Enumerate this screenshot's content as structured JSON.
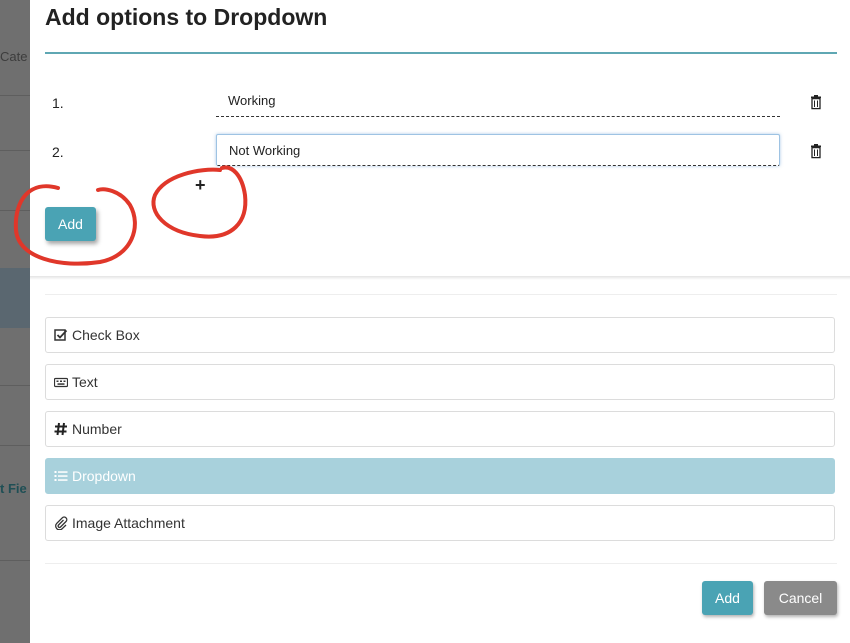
{
  "background_app": {
    "fragments": [
      "Cate",
      "t Fie"
    ]
  },
  "modal": {
    "title": "Add options to Dropdown",
    "options": [
      {
        "number": "1.",
        "value": "Working",
        "delete_icon": "trash-icon"
      },
      {
        "number": "2.",
        "value": "Not Working",
        "delete_icon": "trash-icon"
      }
    ],
    "add_row_symbol": "+",
    "add_option_label": "Add",
    "field_types": [
      {
        "label": "Check Box",
        "icon": "checkbox-icon",
        "selected": false
      },
      {
        "label": "Text",
        "icon": "keyboard-icon",
        "selected": false
      },
      {
        "label": "Number",
        "icon": "hash-icon",
        "selected": false
      },
      {
        "label": "Dropdown",
        "icon": "list-icon",
        "selected": true
      },
      {
        "label": "Image Attachment",
        "icon": "paperclip-icon",
        "selected": false
      }
    ],
    "footer": {
      "add_label": "Add",
      "cancel_label": "Cancel"
    }
  },
  "colors": {
    "accent": "#4aa3b4",
    "selected_row": "#a8d1dc",
    "cancel": "#8a8a8a",
    "annotation": "#e0372a"
  }
}
